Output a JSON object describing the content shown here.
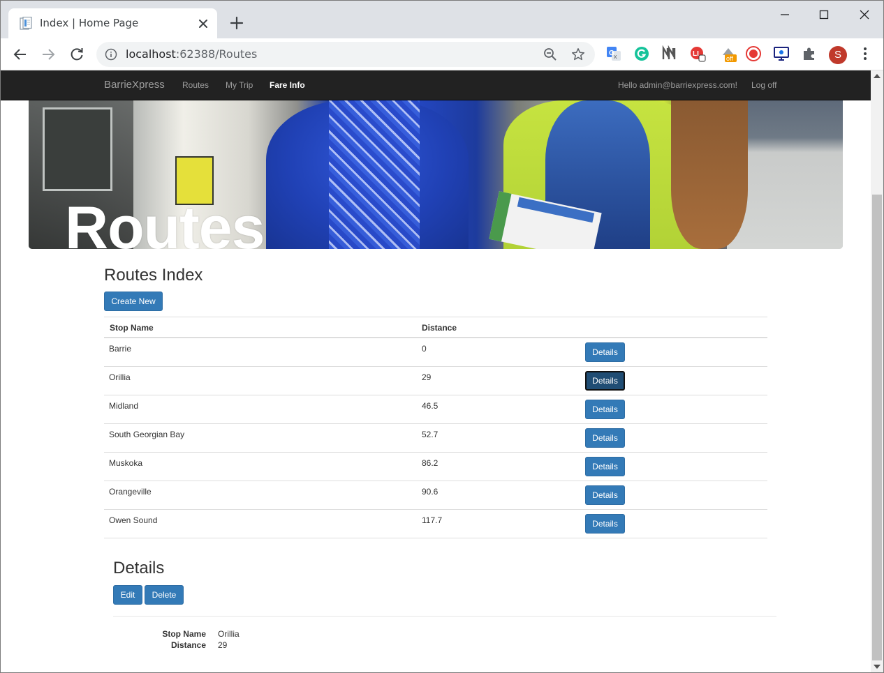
{
  "browser": {
    "tab_title": "Index | Home Page",
    "url_host": "localhost",
    "url_rest": ":62388/Routes",
    "extensions": [
      {
        "name": "google-translate-extension-icon",
        "color": "#4285f4"
      },
      {
        "name": "grammarly-extension-icon",
        "color": "#15c39a"
      },
      {
        "name": "extension-n-icon",
        "color": "#555555"
      },
      {
        "name": "extension-red-icon",
        "color": "#e53935"
      },
      {
        "name": "extension-off-icon",
        "color": "#f29900",
        "badge": "off"
      },
      {
        "name": "record-extension-icon",
        "color": "#e53935"
      },
      {
        "name": "screen-extension-icon",
        "color": "#1a237e"
      },
      {
        "name": "extensions-puzzle-icon",
        "color": "#5f6368"
      }
    ],
    "profile_initial": "S",
    "profile_color": "#c0392b"
  },
  "site": {
    "brand": "BarrieXpress",
    "nav": [
      "Routes",
      "My Trip",
      "Fare Info"
    ],
    "greeting": "Hello admin@barriexpress.com!",
    "logoff": "Log off",
    "accent": "#337ab7"
  },
  "hero": {
    "title": "Routes"
  },
  "index": {
    "heading": "Routes Index",
    "create_label": "Create New",
    "columns": [
      "Stop Name",
      "Distance"
    ],
    "rows": [
      {
        "stop": "Barrie",
        "distance": "0",
        "action": "Details"
      },
      {
        "stop": "Orillia",
        "distance": "29",
        "action": "Details"
      },
      {
        "stop": "Midland",
        "distance": "46.5",
        "action": "Details"
      },
      {
        "stop": "South Georgian Bay",
        "distance": "52.7",
        "action": "Details"
      },
      {
        "stop": "Muskoka",
        "distance": "86.2",
        "action": "Details"
      },
      {
        "stop": "Orangeville",
        "distance": "90.6",
        "action": "Details"
      },
      {
        "stop": "Owen Sound",
        "distance": "117.7",
        "action": "Details"
      }
    ]
  },
  "details": {
    "heading": "Details",
    "edit_label": "Edit",
    "delete_label": "Delete",
    "fields": [
      {
        "label": "Stop Name",
        "value": "Orillia"
      },
      {
        "label": "Distance",
        "value": "29"
      }
    ]
  }
}
